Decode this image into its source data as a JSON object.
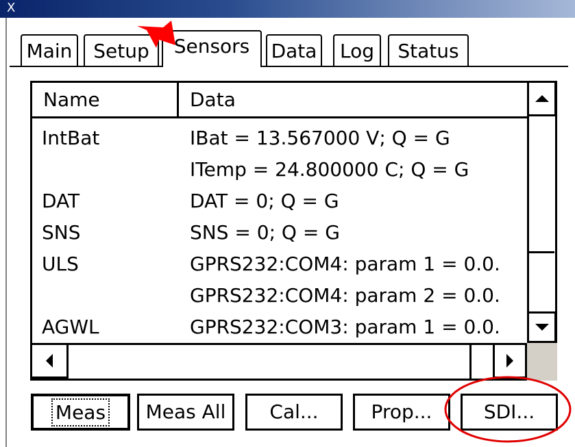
{
  "window": {
    "title_glyph": "X"
  },
  "tabs": [
    {
      "label": "Main"
    },
    {
      "label": "Setup"
    },
    {
      "label": "Sensors",
      "active": true
    },
    {
      "label": "Data"
    },
    {
      "label": "Log"
    },
    {
      "label": "Status"
    }
  ],
  "table": {
    "columns": [
      "Name",
      "Data"
    ],
    "rows": [
      {
        "name": "IntBat",
        "data": "IBat = 13.567000 V; Q = G"
      },
      {
        "name": "",
        "data": "ITemp = 24.800000 C; Q = G"
      },
      {
        "name": "DAT",
        "data": "DAT = 0; Q = G"
      },
      {
        "name": "SNS",
        "data": "SNS = 0; Q = G"
      },
      {
        "name": "ULS",
        "data": "GPRS232:COM4: param 1 = 0.0."
      },
      {
        "name": "",
        "data": "GPRS232:COM4: param 2 = 0.0."
      },
      {
        "name": "AGWL",
        "data": "GPRS232:COM3: param 1 = 0.0."
      }
    ]
  },
  "buttons": {
    "meas": "Meas",
    "meas_all": "Meas All",
    "cal": "Cal...",
    "prop": "Prop...",
    "sdi": "SDI..."
  },
  "annotations": {
    "arrow_color": "#ff0000",
    "circle_color": "#e00000"
  },
  "icons": {
    "scroll_up": "arrow-up-icon",
    "scroll_down": "arrow-down-icon",
    "scroll_left": "arrow-left-icon",
    "scroll_right": "arrow-right-icon"
  }
}
